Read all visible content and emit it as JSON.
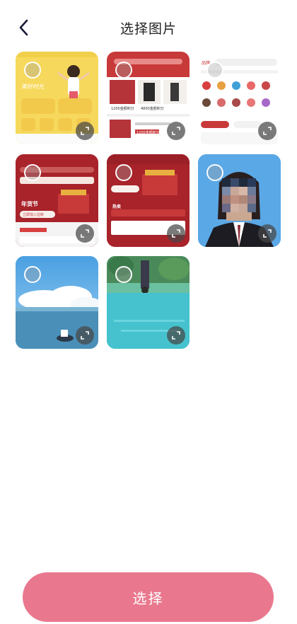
{
  "header": {
    "title": "选择图片"
  },
  "footer": {
    "select_label": "选择"
  },
  "tiles": [
    {
      "id": "yellow-app",
      "caption": "美好时光"
    },
    {
      "id": "red-shop",
      "caption_a": "1200金额积分",
      "caption_b": "4800金额积分",
      "caption_c": "1200金额积分"
    },
    {
      "id": "white-shop",
      "caption": "品牌"
    },
    {
      "id": "red-banner-wide",
      "caption": "年货节",
      "button": "立即加入拉新"
    },
    {
      "id": "red-banner",
      "caption": "热卖"
    },
    {
      "id": "portrait-photo"
    },
    {
      "id": "sky-sea-photo"
    },
    {
      "id": "lake-photo"
    }
  ],
  "colors": {
    "accent": "#e9788e",
    "title": "#222222",
    "back_arrow": "#1a1a3a"
  }
}
